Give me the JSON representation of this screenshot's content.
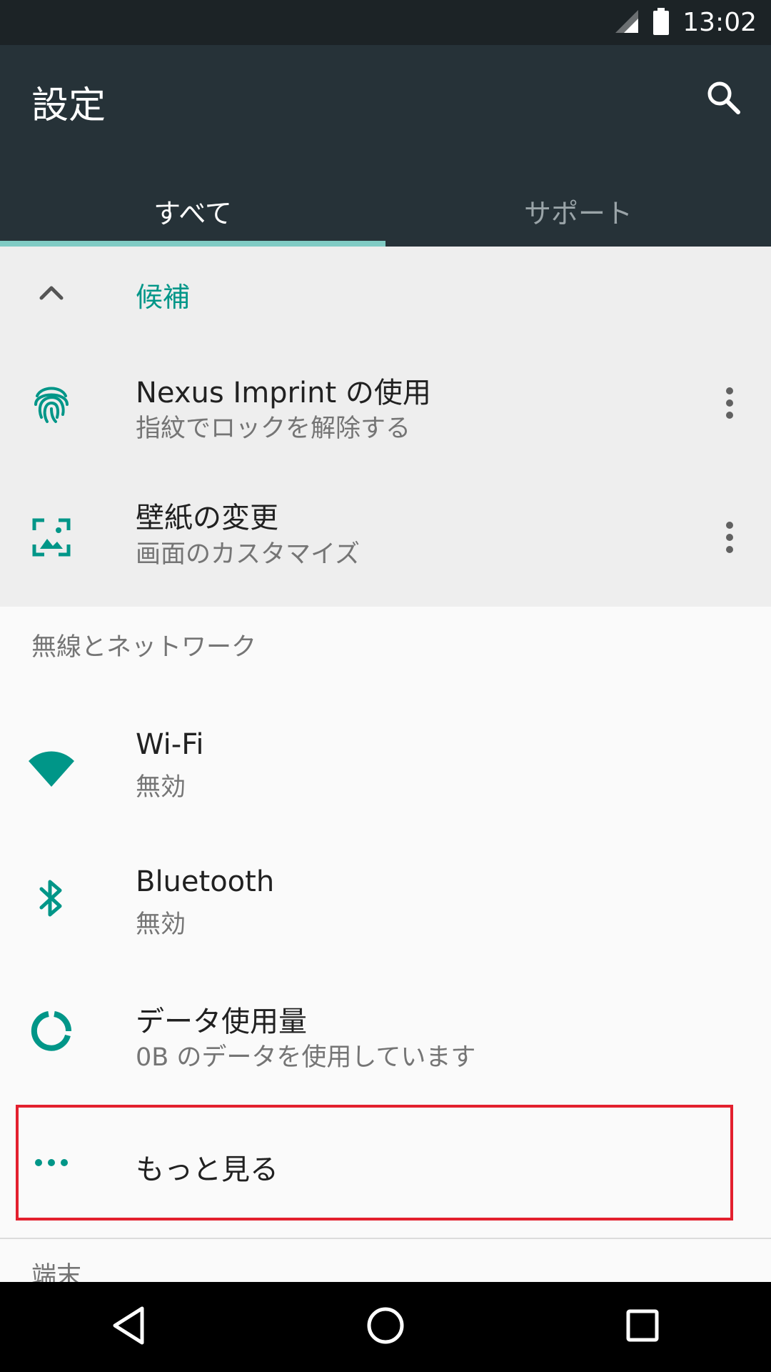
{
  "status_bar": {
    "time": "13:02"
  },
  "app_bar": {
    "title": "設定",
    "tabs": [
      {
        "label": "すべて",
        "active": true
      },
      {
        "label": "サポート",
        "active": false
      }
    ]
  },
  "suggestions": {
    "title": "候補",
    "items": [
      {
        "title": "Nexus Imprint の使用",
        "subtitle": "指紋でロックを解除する",
        "icon": "fingerprint-icon"
      },
      {
        "title": "壁紙の変更",
        "subtitle": "画面のカスタマイズ",
        "icon": "wallpaper-icon"
      }
    ]
  },
  "wireless_section": {
    "label": "無線とネットワーク",
    "items": [
      {
        "title": "Wi-Fi",
        "subtitle": "無効",
        "icon": "wifi-icon"
      },
      {
        "title": "Bluetooth",
        "subtitle": "無効",
        "icon": "bluetooth-icon"
      },
      {
        "title": "データ使用量",
        "subtitle": "0B のデータを使用しています",
        "icon": "data-usage-icon"
      },
      {
        "title": "もっと見る",
        "icon": "more-horiz-icon"
      }
    ]
  },
  "device_section": {
    "label": "端末"
  },
  "colors": {
    "accent": "#009688",
    "app_bar": "#263238",
    "status_bar": "#1c2326",
    "tab_indicator": "#80cbc4",
    "highlight": "#e3202e"
  }
}
